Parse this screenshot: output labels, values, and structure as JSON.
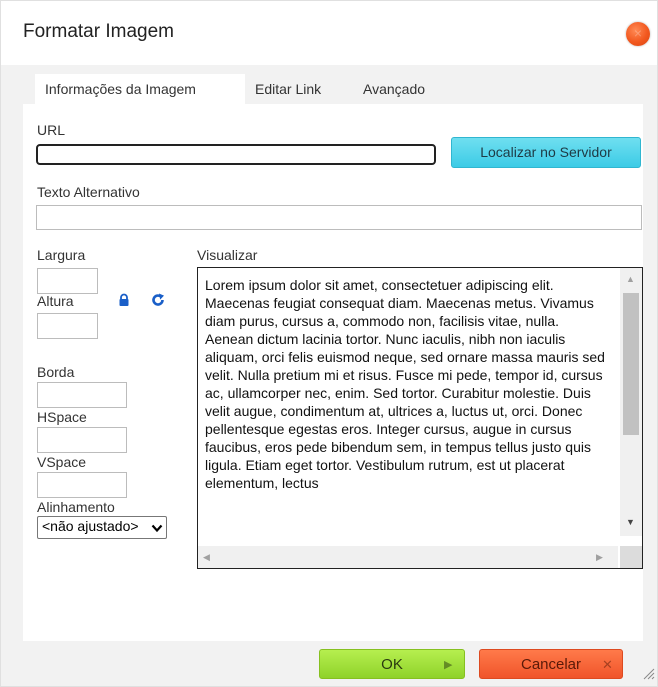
{
  "dialog": {
    "title": "Formatar Imagem",
    "close_icon": "close-icon"
  },
  "tabs": [
    {
      "label": "Informações da Imagem",
      "active": true
    },
    {
      "label": "Editar Link",
      "active": false
    },
    {
      "label": "Avançado",
      "active": false
    }
  ],
  "form": {
    "url_label": "URL",
    "url_value": "",
    "browse_label": "Localizar no Servidor",
    "alt_label": "Texto Alternativo",
    "alt_value": "",
    "width_label": "Largura",
    "width_value": "",
    "height_label": "Altura",
    "height_value": "",
    "border_label": "Borda",
    "border_value": "",
    "hspace_label": "HSpace",
    "hspace_value": "",
    "vspace_label": "VSpace",
    "vspace_value": "",
    "align_label": "Alinhamento",
    "align_value": "<não ajustado>",
    "lock_icon": "lock-icon",
    "reset_icon": "refresh-icon"
  },
  "preview": {
    "label": "Visualizar",
    "text": "Lorem ipsum dolor sit amet, consectetuer adipiscing elit. Maecenas feugiat consequat diam. Maecenas metus. Vivamus diam purus, cursus a, commodo non, facilisis vitae, nulla. Aenean dictum lacinia tortor. Nunc iaculis, nibh non iaculis aliquam, orci felis euismod neque, sed ornare massa mauris sed velit. Nulla pretium mi et risus. Fusce mi pede, tempor id, cursus ac, ullamcorper nec, enim. Sed tortor. Curabitur molestie. Duis velit augue, condimentum at, ultrices a, luctus ut, orci. Donec pellentesque egestas eros. Integer cursus, augue in cursus faucibus, eros pede bibendum sem, in tempus tellus justo quis ligula. Etiam eget tortor. Vestibulum rutrum, est ut placerat elementum, lectus"
  },
  "buttons": {
    "ok_label": "OK",
    "cancel_label": "Cancelar"
  },
  "colors": {
    "ok": "#9ee03a",
    "cancel": "#f25f30",
    "browse": "#4fd3ea",
    "close": "#f2581f",
    "icon_blue": "#1a5fc8"
  }
}
